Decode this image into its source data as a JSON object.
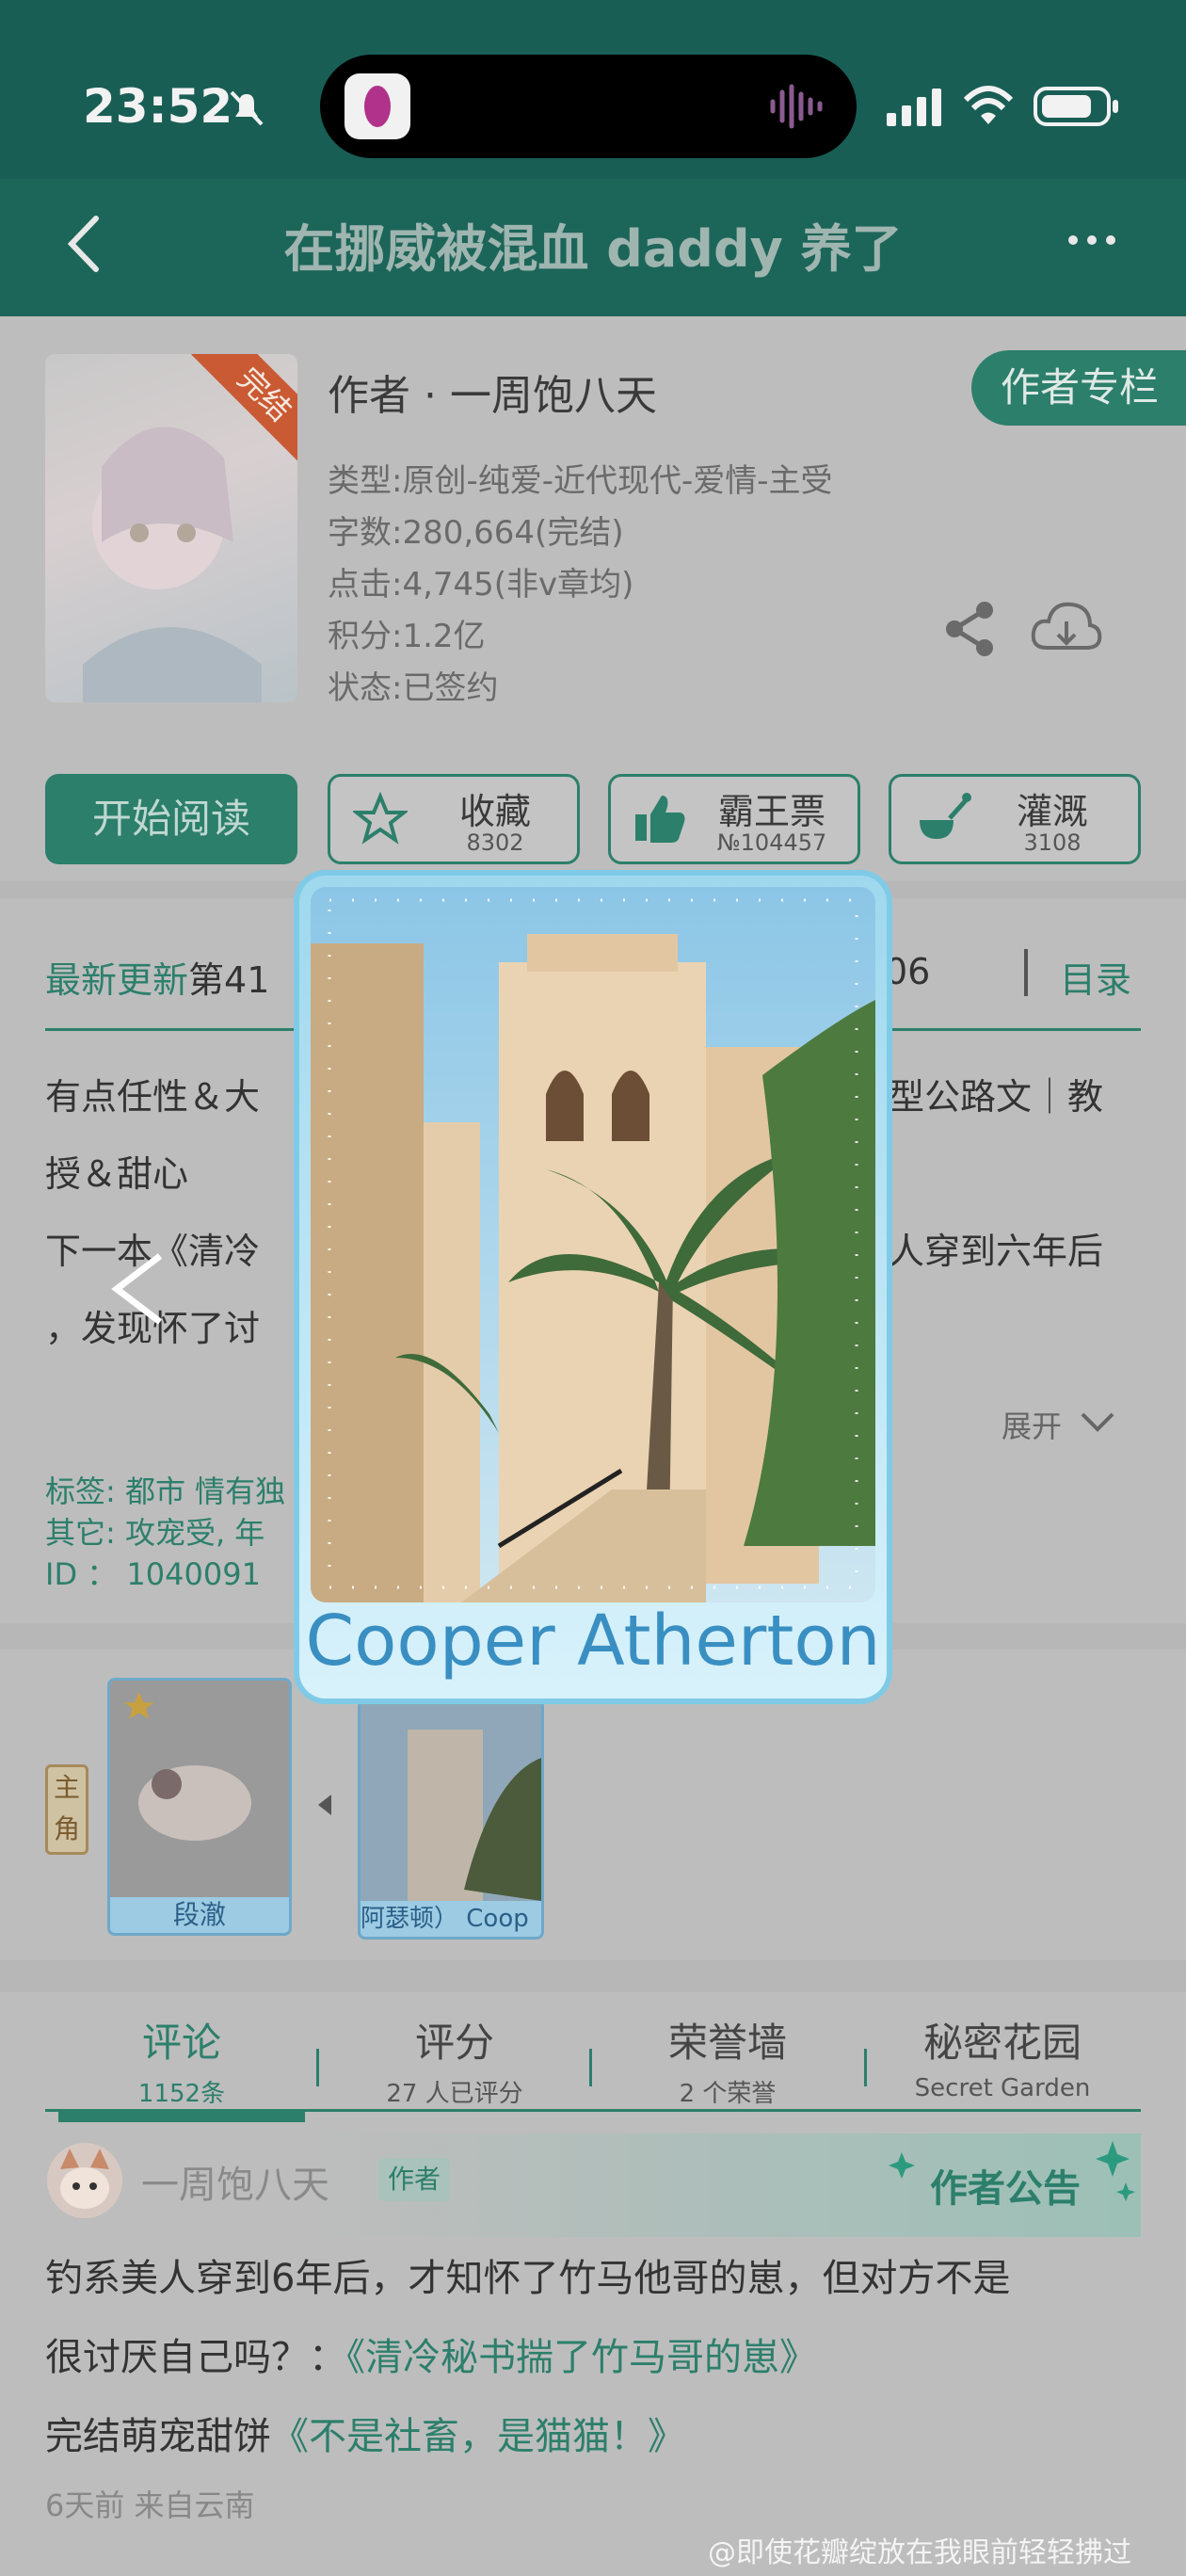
{
  "status": {
    "time": "23:52"
  },
  "nav": {
    "title": "在挪威被混血 daddy 养了"
  },
  "book": {
    "cover_badge": "完结",
    "author_line": "作者 · 一周饱八天",
    "author_column_btn": "作者专栏",
    "type": "类型:原创-纯爱-近代现代-爱情-主受",
    "words": "字数:280,664(完结)",
    "clicks": "点击:4,745(非v章均)",
    "points": "积分:1.2亿",
    "status": "状态:已签约"
  },
  "actions": {
    "read": "开始阅读",
    "collect": {
      "label": "收藏",
      "count": "8302"
    },
    "vote": {
      "label": "霸王票",
      "count": "№104457"
    },
    "water": {
      "label": "灌溉",
      "count": "3108"
    }
  },
  "update": {
    "label": "最新更新",
    "chapter": "第41",
    "date_tail": "06",
    "catalog": "目录",
    "desc1a": "有点任性＆大",
    "desc1b": "型公路文｜教",
    "desc2": "授＆甜心",
    "desc3a": "下一本《清冷",
    "desc3b": "人穿到六年后",
    "desc4": "，发现怀了讨",
    "expand": "展开",
    "tags": "标签: 都市  情有独",
    "other": "其它: 攻宠受, 年",
    "id": "ID ： 1040091"
  },
  "roles": {
    "label": "主角",
    "card1_name": "段澈",
    "card2_name": "阿瑟顿）  Coop"
  },
  "tabs": [
    {
      "title": "评论",
      "sub": "1152条"
    },
    {
      "title": "评分",
      "sub": "27 人已评分"
    },
    {
      "title": "荣誉墙",
      "sub": "2 个荣誉"
    },
    {
      "title": "秘密花园",
      "sub": "Secret Garden"
    }
  ],
  "comment": {
    "user": "一周饱八天",
    "badge": "作者",
    "notice": "作者公告",
    "line1": "钓系美人穿到6年后，才知怀了竹马他哥的崽，但对方不是",
    "line2a": "很讨厌自己吗？：",
    "line2b": "《清冷秘书揣了竹马哥的崽》",
    "line3a": "完结萌宠甜饼",
    "line3b": "《不是社畜，是猫猫！》",
    "meta": "6天前   来自云南"
  },
  "modal": {
    "name": "Cooper Atherton",
    "prev": "<"
  },
  "watermark": "@即使花瓣绽放在我眼前轻轻拂过"
}
